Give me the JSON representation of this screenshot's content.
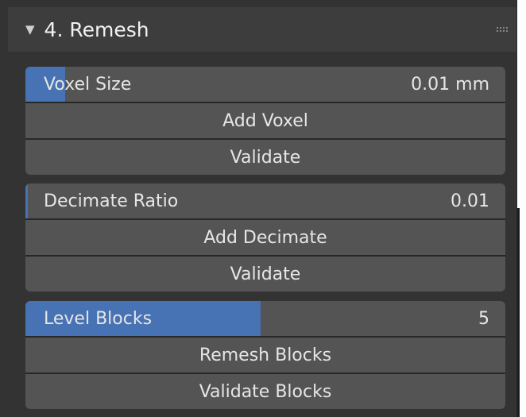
{
  "panel": {
    "title": "4. Remesh",
    "collapse_glyph": "▼"
  },
  "sections": [
    {
      "slider": {
        "label": "Voxel Size",
        "value": "0.01 mm",
        "fill_fraction": 0.083
      },
      "buttons": [
        "Add Voxel",
        "Validate"
      ]
    },
    {
      "slider": {
        "label": "Decimate Ratio",
        "value": "0.01",
        "fill_fraction": 0.005
      },
      "buttons": [
        "Add Decimate",
        "Validate"
      ]
    },
    {
      "slider": {
        "label": "Level Blocks",
        "value": "5",
        "fill_fraction": 0.49
      },
      "buttons": [
        "Remesh Blocks",
        "Validate Blocks"
      ]
    }
  ],
  "colors": {
    "panel_bg": "#333333",
    "header_bg": "#3d3d3d",
    "widget_bg": "#545454",
    "slider_fill": "#4772b3",
    "text": "#e6e6e6"
  }
}
